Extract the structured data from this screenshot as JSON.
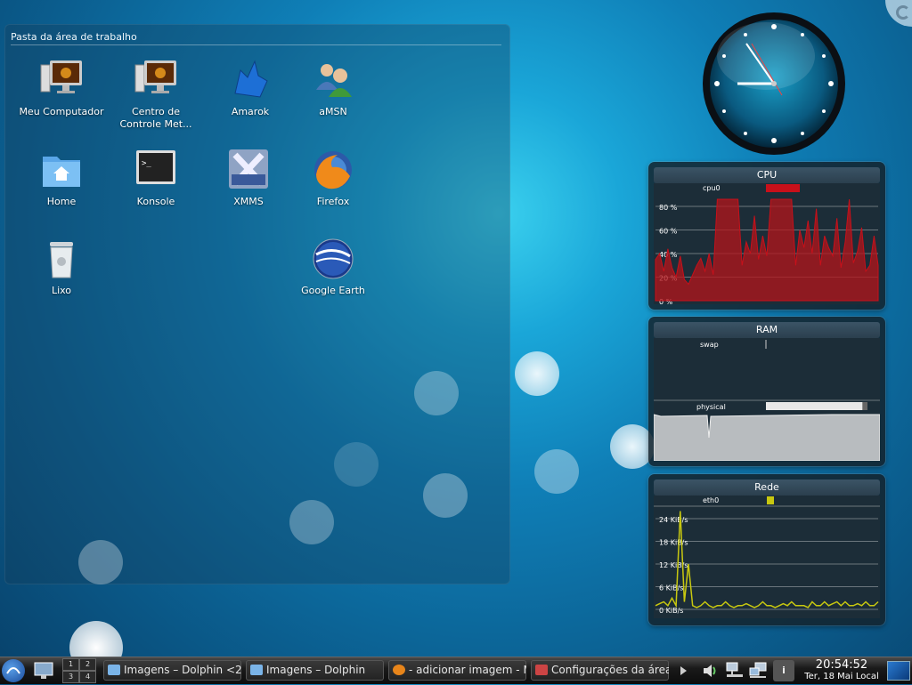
{
  "folder_view": {
    "title": "Pasta da área de trabalho",
    "icons": [
      {
        "label": "Meu Computador",
        "icon": "computer-icon"
      },
      {
        "label": "Centro de Controle Met...",
        "icon": "control-center-icon"
      },
      {
        "label": "Amarok",
        "icon": "amarok-wolf-icon"
      },
      {
        "label": "aMSN",
        "icon": "amsn-buddies-icon"
      },
      {
        "label": "Home",
        "icon": "home-folder-icon"
      },
      {
        "label": "Konsole",
        "icon": "terminal-icon"
      },
      {
        "label": "XMMS",
        "icon": "xmms-icon"
      },
      {
        "label": "Firefox",
        "icon": "firefox-icon"
      },
      {
        "label": "Lixo",
        "icon": "trash-icon"
      },
      {
        "label": "Google Earth",
        "icon": "google-earth-icon"
      }
    ]
  },
  "cpu_monitor": {
    "title": "CPU",
    "legend": "cpu0",
    "ticks": [
      "80 %",
      "60 %",
      "40 %",
      "20 %",
      "0 %"
    ],
    "color": "#c8101a",
    "samples": [
      35,
      40,
      25,
      44,
      28,
      20,
      38,
      18,
      14,
      22,
      30,
      36,
      25,
      40,
      22,
      88,
      95,
      95,
      95,
      95,
      95,
      30,
      50,
      40,
      72,
      35,
      55,
      38,
      95,
      95,
      95,
      95,
      95,
      95,
      30,
      60,
      45,
      68,
      40,
      78,
      30,
      55,
      45,
      38,
      70,
      28,
      50,
      90,
      32,
      42,
      62,
      25,
      30,
      55,
      30
    ]
  },
  "ram_monitor": {
    "title": "RAM",
    "swap_label": "swap",
    "physical_label": "physical",
    "physical_used_fraction": 0.95
  },
  "net_monitor": {
    "title": "Rede",
    "legend": "eth0",
    "ticks": [
      "24 KiB/s",
      "18 KiB/s",
      "12 KiB/s",
      "6 KiB/s",
      "0 KiB/s"
    ],
    "color": "#c8c810",
    "samples": [
      1,
      1.5,
      2,
      1,
      3,
      1,
      26,
      2,
      12,
      1,
      0.5,
      1,
      2,
      1,
      0.5,
      1,
      1,
      2,
      1,
      0.5,
      1,
      1,
      1.5,
      1,
      0.5,
      1,
      2,
      1,
      1,
      0.5,
      1,
      1.5,
      1,
      2,
      1,
      1,
      1,
      0.5,
      2,
      1,
      1,
      2,
      1,
      1.5,
      2,
      1,
      2,
      1,
      1,
      1.5,
      1,
      2,
      1,
      1,
      2
    ]
  },
  "taskbar": {
    "pager": [
      "1",
      "2",
      "3",
      "4"
    ],
    "tasks": [
      {
        "label": "Imagens – Dolphin <2",
        "icon": "dolphin-icon"
      },
      {
        "label": "Imagens – Dolphin",
        "icon": "dolphin-icon"
      },
      {
        "label": "- adicionar imagem - M",
        "icon": "firefox-icon"
      },
      {
        "label": "Configurações da área",
        "icon": "settings-icon"
      }
    ],
    "time": "20:54:52",
    "date": "Ter, 18 Mai Local"
  }
}
